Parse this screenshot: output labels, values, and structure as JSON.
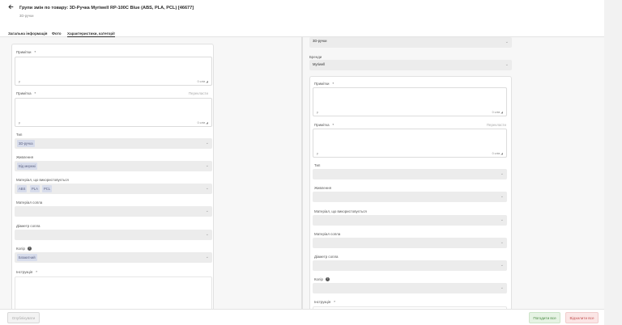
{
  "header": {
    "back_icon": "arrow-left-icon",
    "title": "Групи змін по товару: 3D-Ручка Myriwell RP-100C Blue (ABS, PLA, PCL) [46677]",
    "subtitle": "3D-ручки"
  },
  "tabs": [
    {
      "label": "Загальна інформація"
    },
    {
      "label": "Фото"
    },
    {
      "label": "Характеристики, категорії"
    }
  ],
  "left_form": {
    "notes_label": "Примітки",
    "notes_footer_left": "p",
    "notes_footer_right": "0 слів",
    "notice_label": "Примітка",
    "notice_translate": "Перекласти",
    "notice_footer_left": "p",
    "notice_footer_right": "0 слів",
    "type_label": "Тип",
    "type_value": "3D-ручка",
    "power_label": "Живлення",
    "power_value": "Від мережі",
    "material_label": "Матеріал, що використовується",
    "materials": [
      "ABS",
      "PLA",
      "PCL"
    ],
    "nozzle_material_label": "Матеріал сопла",
    "nozzle_diameter_label": "Діаметр сопла",
    "color_label": "Колір",
    "color_value": "Блакитний",
    "instruction_label": "Інструкція"
  },
  "right_form": {
    "top_select_value": "3D-ручки",
    "brand_label": "Бренди",
    "brand_value": "Myriwell",
    "notes_label": "Примітки",
    "notes_footer_left": "p",
    "notes_footer_right": "0 слів",
    "notice_label": "Примітка",
    "notice_translate": "Перекласти",
    "notice_footer_left": "p",
    "notice_footer_right": "0 слів",
    "type_label": "Тип",
    "power_label": "Живлення",
    "material_label": "Матеріал, що використовується",
    "nozzle_material_label": "Матеріал сопла",
    "nozzle_diameter_label": "Діаметр сопла",
    "color_label": "Колір",
    "instruction_label": "Інструкція"
  },
  "footer": {
    "publish_label": "Опублікувати",
    "accept_all_label": "Погодити все",
    "reject_all_label": "Відхилити все"
  },
  "colors": {
    "accept": "#4a8a43",
    "reject": "#c45454",
    "chip": "#d7dceb"
  }
}
